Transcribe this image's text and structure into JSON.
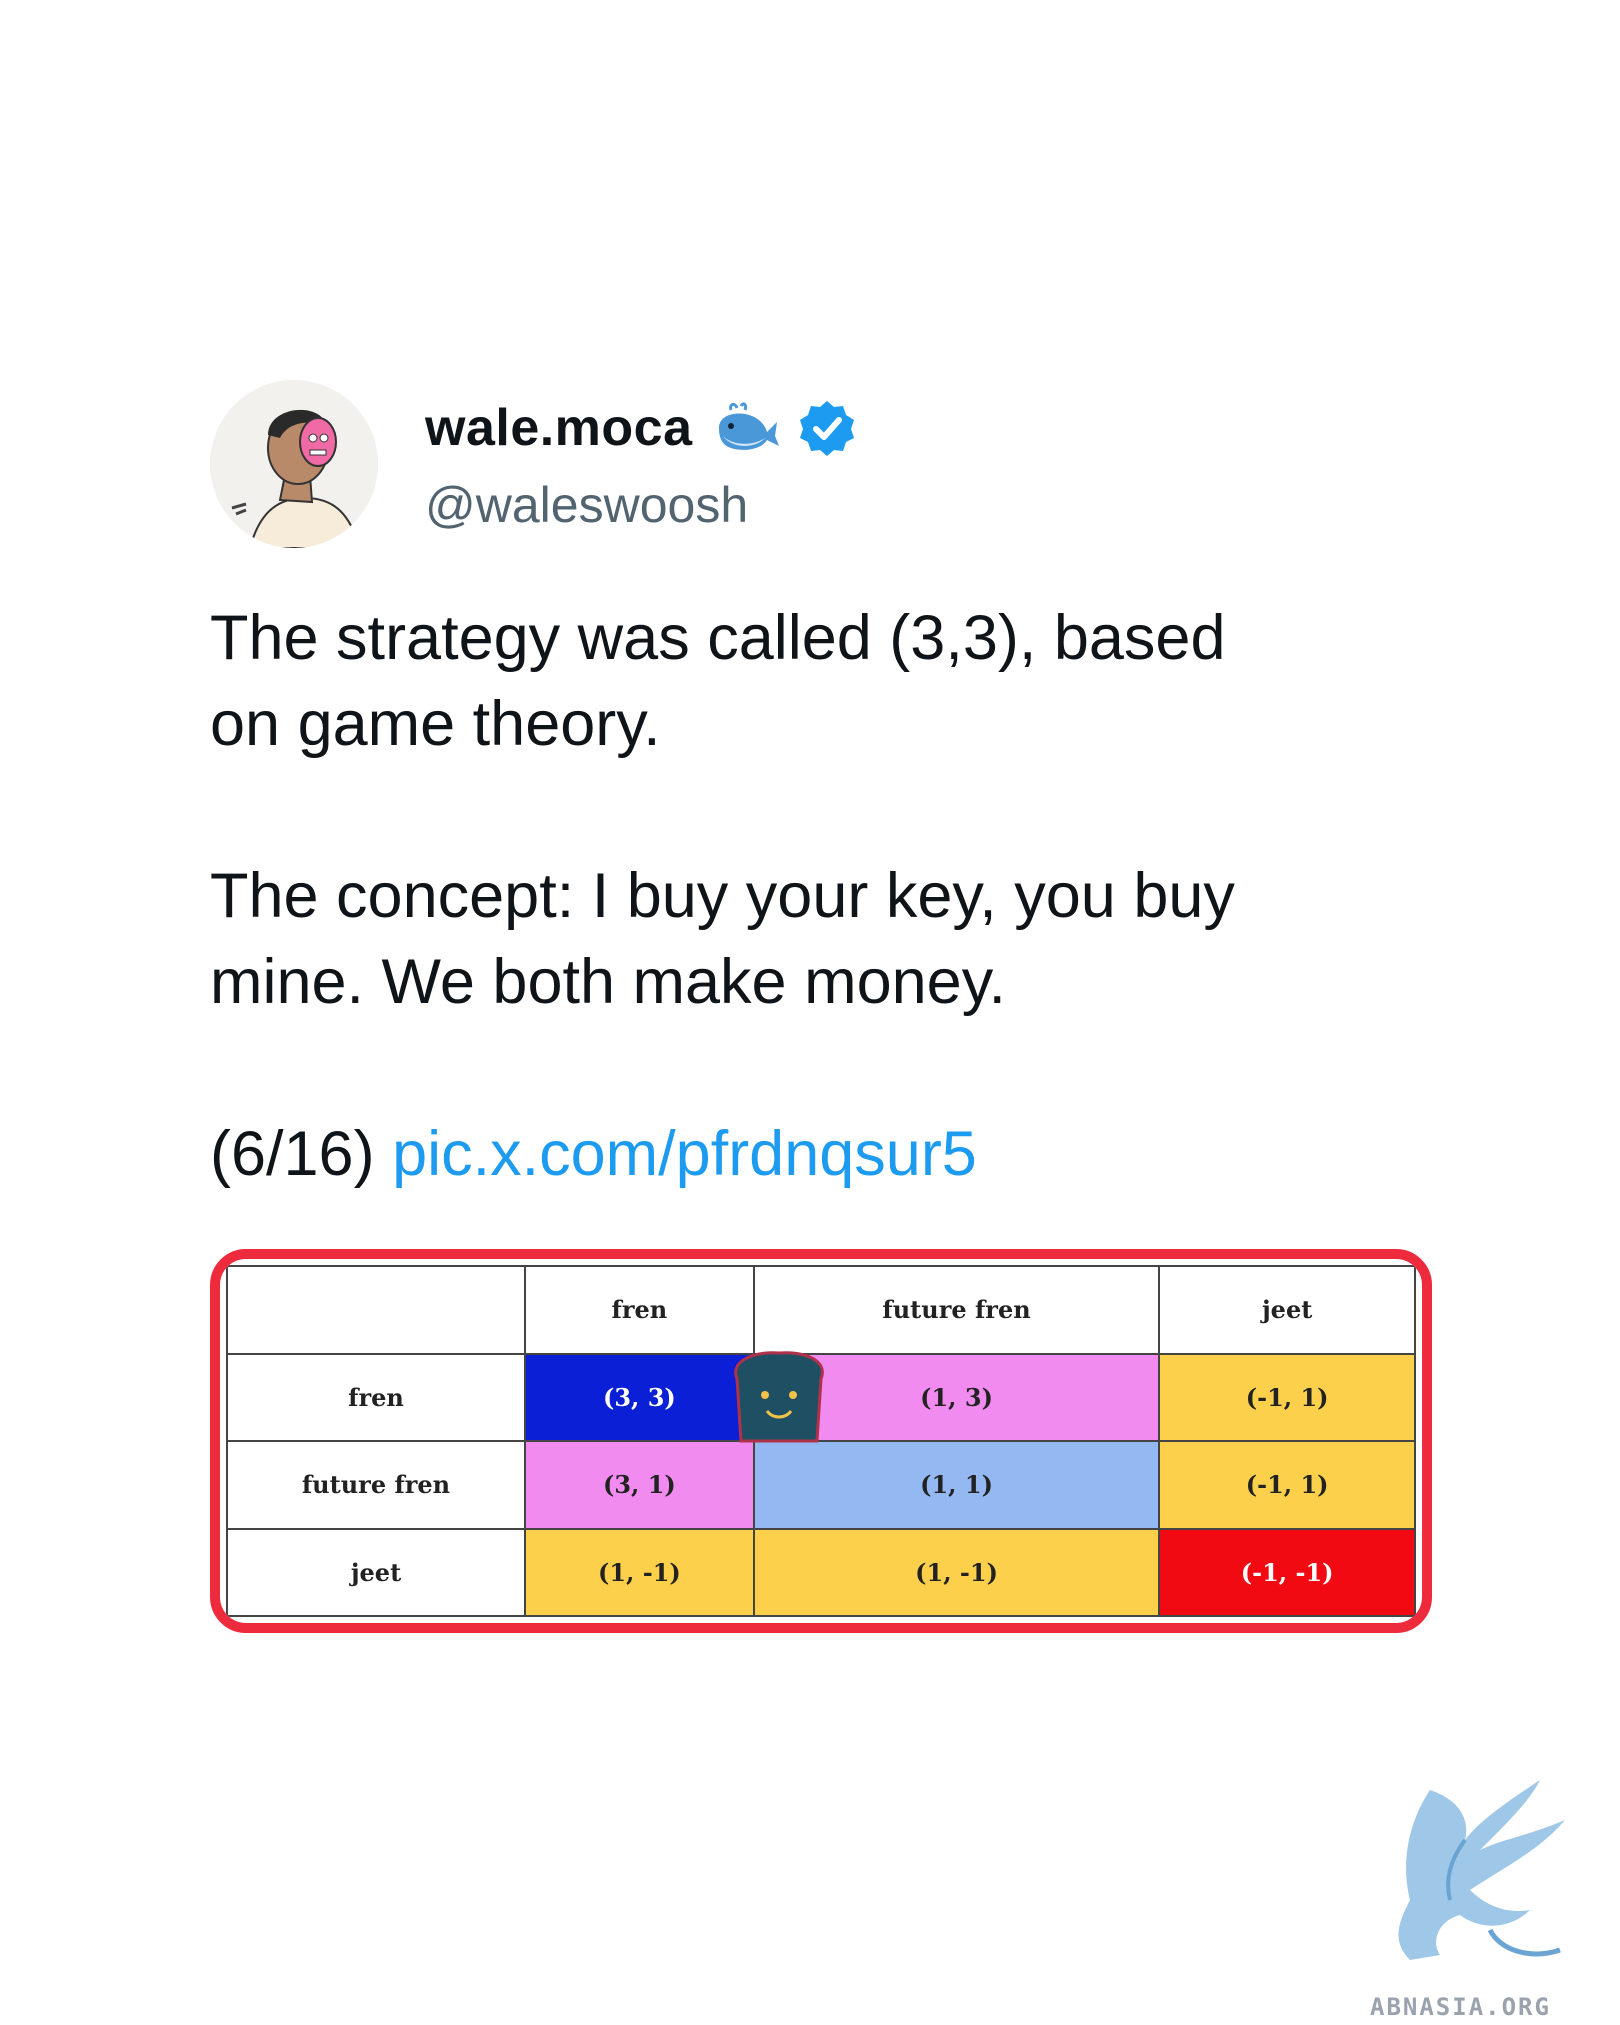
{
  "tweet": {
    "display_name": "wale.moca",
    "handle": "@waleswoosh",
    "paragraphs": [
      "The strategy was called (3,3), based\non game theory.",
      "The concept: I buy your key, you buy\nmine. We both make money."
    ],
    "thread_counter": "(6/16)",
    "link": "pic.x.com/pfrdnqsur5"
  },
  "media": {
    "columns": [
      "fren",
      "future fren",
      "jeet"
    ],
    "rows": [
      {
        "label": "fren",
        "cells": [
          "(3, 3)",
          "(1, 3)",
          "(-1, 1)"
        ]
      },
      {
        "label": "future fren",
        "cells": [
          "(3, 1)",
          "(1, 1)",
          "(-1, 1)"
        ]
      },
      {
        "label": "jeet",
        "cells": [
          "(1, -1)",
          "(1, -1)",
          "(-1, -1)"
        ]
      }
    ],
    "cell_colors": [
      [
        "#0a1fd6",
        "#f28bf0",
        "#fcd04a"
      ],
      [
        "#f28bf0",
        "#94b8f2",
        "#fcd04a"
      ],
      [
        "#fcd04a",
        "#fcd04a",
        "#f20a12"
      ]
    ],
    "frame_color": "#ee2a3d"
  },
  "watermark": {
    "text": "ABNASIA.ORG"
  },
  "icons": {
    "whale": "whale-emoji-icon",
    "verified": "verified-badge-icon",
    "mascot": "toast-mascot-icon",
    "logo": "griffin-logo-icon"
  }
}
